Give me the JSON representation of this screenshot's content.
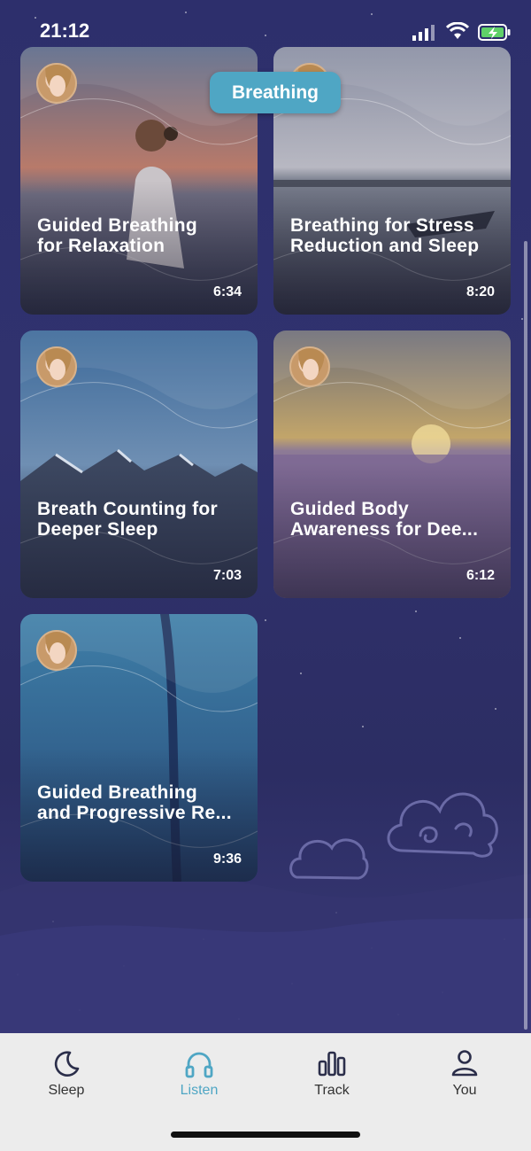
{
  "status_bar": {
    "time": "21:12"
  },
  "category_pill": "Breathing",
  "cards": [
    {
      "title": "Guided Breathing\nfor Relaxation",
      "duration": "6:34",
      "scene": "woman-sunset-icon"
    },
    {
      "title": "Breathing for Stress\nReduction and Sleep",
      "duration": "8:20",
      "scene": "lake-boat-icon"
    },
    {
      "title": "Breath Counting for\nDeeper Sleep",
      "duration": "7:03",
      "scene": "mountains-icon"
    },
    {
      "title": "Guided Body\nAwareness for Dee...",
      "duration": "6:12",
      "scene": "lavender-field-icon"
    },
    {
      "title": "Guided Breathing\nand Progressive Re...",
      "duration": "9:36",
      "scene": "ocean-aerial-icon"
    }
  ],
  "tabs": [
    {
      "label": "Sleep",
      "icon": "moon-icon",
      "active": false
    },
    {
      "label": "Listen",
      "icon": "headphones-icon",
      "active": true
    },
    {
      "label": "Track",
      "icon": "bar-chart-icon",
      "active": false
    },
    {
      "label": "You",
      "icon": "person-icon",
      "active": false
    }
  ],
  "colors": {
    "accent": "#4fa6c4",
    "background": "#2d2f6c",
    "tabbar": "#ececec"
  }
}
